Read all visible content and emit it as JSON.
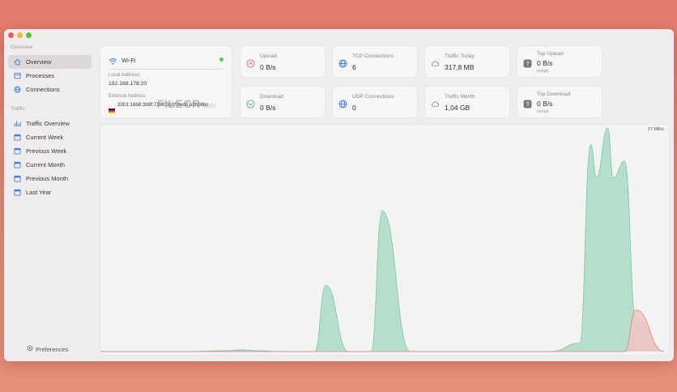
{
  "sidebar": {
    "sections": [
      {
        "label": "Overview",
        "items": [
          {
            "label": "Overview",
            "icon": "house-icon",
            "active": true
          },
          {
            "label": "Processes",
            "icon": "processes-icon"
          },
          {
            "label": "Connections",
            "icon": "globe-icon"
          }
        ]
      },
      {
        "label": "Traffic",
        "items": [
          {
            "label": "Traffic Overview",
            "icon": "bar-chart-icon"
          },
          {
            "label": "Current Week",
            "icon": "calendar-icon"
          },
          {
            "label": "Previous Week",
            "icon": "calendar-icon"
          },
          {
            "label": "Current Month",
            "icon": "calendar-icon"
          },
          {
            "label": "Previous Month",
            "icon": "calendar-icon"
          },
          {
            "label": "Last Year",
            "icon": "calendar-icon"
          }
        ]
      }
    ],
    "preferences_label": "Preferences"
  },
  "wifi": {
    "title": "Wi-Fi",
    "status_color": "#5cc35a",
    "local_label": "Local Address:",
    "local_value": "192.168.178.20",
    "external_label": "External Address:",
    "external_value": "2001:16b8:2b9f:7100:3c0f:9ec8:e2f:b6bc"
  },
  "stats": {
    "upload": {
      "label": "Upload",
      "value": "0 B/s",
      "icon": "upload-icon"
    },
    "download": {
      "label": "Download",
      "value": "0 B/s",
      "icon": "download-icon"
    },
    "tcp": {
      "label": "TCP Connections",
      "value": "6",
      "icon": "globe-icon"
    },
    "udp": {
      "label": "UDP Connections",
      "value": "0",
      "icon": "globe-icon"
    },
    "today": {
      "label": "Traffic Today",
      "value": "317,8 MB",
      "icon": "cloud-icon"
    },
    "month": {
      "label": "Traffic Month",
      "value": "1,04 GB",
      "icon": "cloud-icon"
    },
    "top_upload": {
      "label": "Top Upload",
      "value": "0 B/s",
      "sub": "rentpd",
      "icon": "app-icon"
    },
    "top_download": {
      "label": "Top Download",
      "value": "0 B/s",
      "sub": "rentpd",
      "icon": "app-icon"
    }
  },
  "watermark": {
    "brand": "FILECR",
    "tld": ".com"
  },
  "colors": {
    "download": "#a9d9c4",
    "download_stroke": "#78c6a4",
    "upload": "#f2c6c2",
    "upload_stroke": "#e07e75",
    "accent": "#3f7ee0"
  },
  "chart_data": {
    "type": "area",
    "ymax_label": "27 MB/s",
    "ylim": [
      0,
      27
    ],
    "x": [
      0,
      16,
      22,
      25,
      28,
      32,
      38,
      40,
      44,
      48,
      50,
      55,
      66,
      70,
      72,
      74,
      80,
      85,
      87,
      88,
      90,
      91,
      93,
      95,
      100
    ],
    "series": [
      {
        "name": "Download",
        "values": [
          0,
          0,
          0.1,
          0.2,
          0.1,
          0,
          0,
          8,
          0,
          0,
          17,
          0,
          0,
          0,
          0,
          0,
          0,
          1,
          25,
          21,
          27,
          21,
          23,
          4,
          0
        ]
      },
      {
        "name": "Upload",
        "values": [
          0,
          0,
          0,
          0,
          0,
          0,
          0,
          0,
          0,
          0,
          0,
          0,
          0,
          0,
          0,
          0,
          0,
          0,
          0,
          0,
          0,
          0,
          0,
          5,
          0
        ]
      }
    ]
  }
}
